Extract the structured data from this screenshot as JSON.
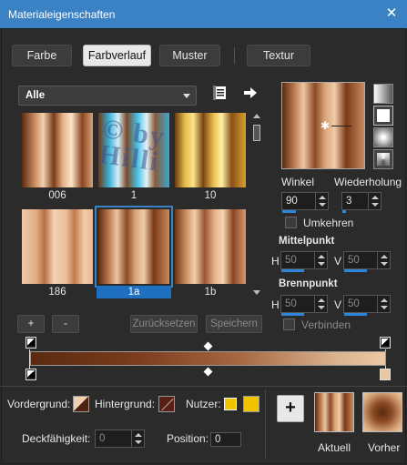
{
  "window": {
    "title": "Materialeigenschaften",
    "close_glyph": "✕"
  },
  "tabs": [
    {
      "label": "Farbe",
      "active": false
    },
    {
      "label": "Farbverlauf",
      "active": true
    },
    {
      "label": "Muster",
      "active": false
    },
    {
      "label": "Textur",
      "active": false
    }
  ],
  "category": {
    "selected": "Alle"
  },
  "icons": {
    "library": "library-icon",
    "arrow": "arrow-right-icon"
  },
  "swatches": [
    {
      "caption": "006",
      "selected": false
    },
    {
      "caption": "1",
      "selected": false
    },
    {
      "caption": "10",
      "selected": false
    },
    {
      "caption": "186",
      "selected": false
    },
    {
      "caption": "1a",
      "selected": true
    },
    {
      "caption": "1b",
      "selected": false
    }
  ],
  "watermark": "© by Hilli",
  "list_buttons": {
    "add": "+",
    "remove": "-",
    "reset": "Zurücksetzen",
    "save": "Speichern"
  },
  "angle": {
    "label": "Winkel",
    "value": "90"
  },
  "repeat": {
    "label": "Wiederholung",
    "value": "3"
  },
  "invert": {
    "label": "Umkehren"
  },
  "center": {
    "label": "Mittelpunkt",
    "h_label": "H",
    "h": "50",
    "v_label": "V",
    "v": "50"
  },
  "focal": {
    "label": "Brennpunkt",
    "h_label": "H",
    "h": "50",
    "v_label": "V",
    "v": "50"
  },
  "link": {
    "label": "Verbinden"
  },
  "bottom": {
    "foreground_label": "Vordergrund:",
    "background_label": "Hintergrund:",
    "user_label": "Nutzer:",
    "opacity_label": "Deckfähigkeit:",
    "opacity_value": "0",
    "position_label": "Position:",
    "position_value": "0",
    "add_glyph": "+",
    "current_label": "Aktuell",
    "previous_label": "Vorher"
  },
  "colors": {
    "accent": "#3b82c4",
    "user_color": "#f2c400",
    "background_color": "#5a1e14",
    "gradient_dark": "#5a2a10",
    "gradient_light": "#e8c4a0"
  }
}
